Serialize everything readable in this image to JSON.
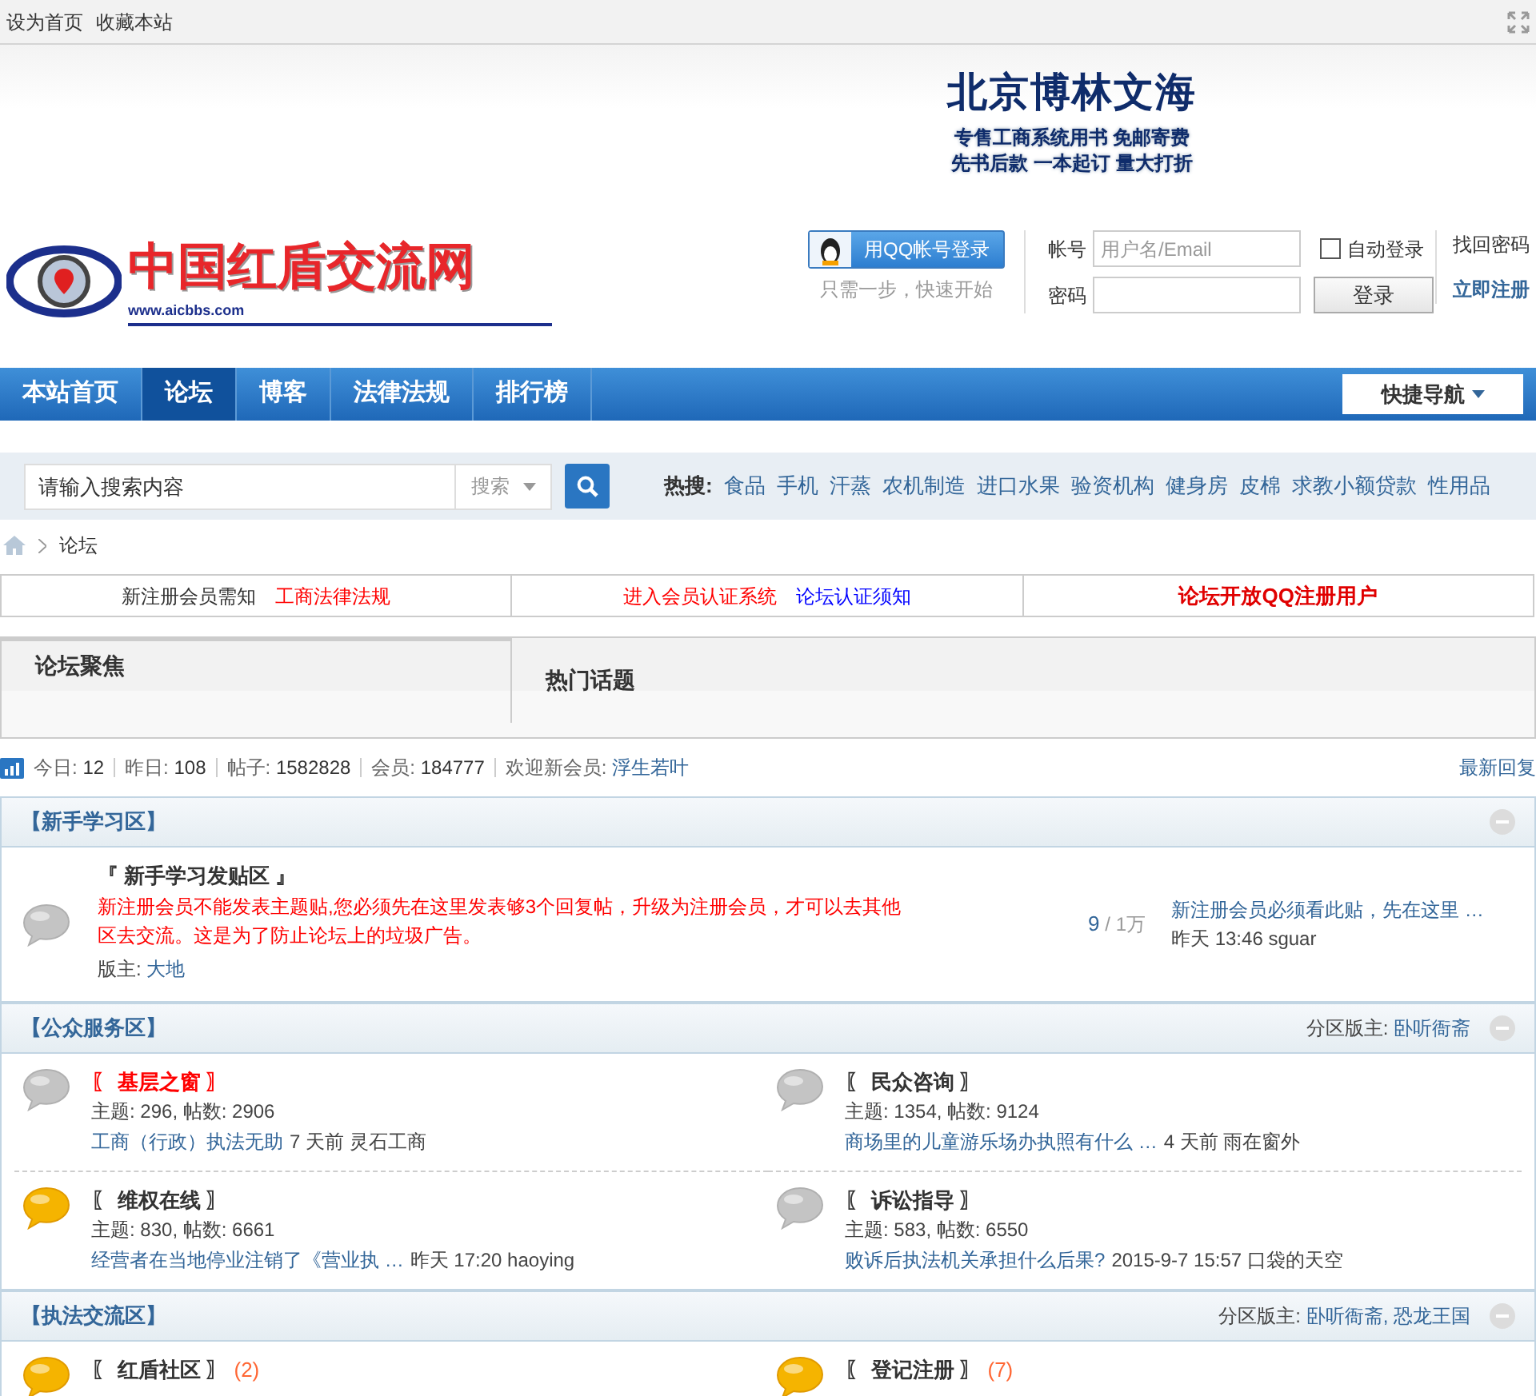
{
  "top_links": [
    "设为首页",
    "收藏本站"
  ],
  "ad": {
    "title": "北京博林文海",
    "lines": [
      "专售工商系统用书  免邮寄费",
      "先书后款  一本起订  量大打折"
    ]
  },
  "logo": {
    "title": "中国红盾交流网",
    "url": "www.aicbbs.com"
  },
  "qq_login": {
    "button": "用QQ帐号登录",
    "hint": "只需一步，快速开始"
  },
  "login": {
    "username_label": "帐号",
    "username_placeholder": "用户名/Email",
    "auto_login": {
      "label": "自动登录",
      "checked": false
    },
    "password_label": "密码",
    "submit": "登录",
    "forgot": "找回密码",
    "register": "立即注册"
  },
  "nav": {
    "items": [
      {
        "label": "本站首页",
        "selected": false
      },
      {
        "label": "论坛",
        "selected": true
      },
      {
        "label": "博客",
        "selected": false
      },
      {
        "label": "法律法规",
        "selected": false
      },
      {
        "label": "排行榜",
        "selected": false
      }
    ],
    "quick_nav": "快捷导航"
  },
  "search": {
    "placeholder": "请输入搜索内容",
    "type": "搜索",
    "hot_label": "热搜:",
    "hot": [
      "食品",
      "手机",
      "汗蒸",
      "农机制造",
      "进口水果",
      "验资机构",
      "健身房",
      "皮棉",
      "求教小额贷款",
      "性用品"
    ]
  },
  "breadcrumb": [
    "论坛"
  ],
  "notices": [
    {
      "links": [
        {
          "text": "新注册会员需知",
          "color": "#333333"
        },
        {
          "text": "工商法律法规",
          "color": "#ff0000"
        }
      ]
    },
    {
      "links": [
        {
          "text": "进入会员认证系统",
          "color": "#ff0000"
        },
        {
          "text": "论坛认证须知",
          "color": "#0000ff"
        }
      ]
    },
    {
      "links": [
        {
          "text": "论坛开放QQ注册用户",
          "color": "#e00000"
        }
      ]
    }
  ],
  "focus_tabs": [
    {
      "label": "论坛聚焦",
      "selected": true
    },
    {
      "label": "热门话题",
      "selected": false
    }
  ],
  "stats": [
    {
      "label": "今日:",
      "value": "12"
    },
    {
      "label": "昨日:",
      "value": "108"
    },
    {
      "label": "帖子:",
      "value": "1582828"
    },
    {
      "label": "会员:",
      "value": "184777"
    }
  ],
  "new_member": {
    "label": "欢迎新会员:",
    "name": "浮生若叶"
  },
  "latest_replies": "最新回复",
  "sections": [
    {
      "title": "【新手学习区】",
      "kind": "wide",
      "forums": [
        {
          "name": "『 新手学习发贴区 』",
          "new": false,
          "description": "新注册会员不能发表主题贴,您必须先在这里发表够3个回复帖，升级为注册会员，才可以去其他区去交流。这是为了防止论坛上的垃圾广告。",
          "moderator_label": "版主:",
          "moderator": "大地",
          "threads": "9",
          "separator": "/",
          "posts": "1万",
          "last_title": "新注册会员必须看此贴，先在这里 …",
          "last_meta": "昨天 13:46 sguar"
        }
      ]
    },
    {
      "title": "【公众服务区】",
      "kind": "grid",
      "moderators_label": "分区版主:",
      "moderators": "卧听衙斋",
      "forums": [
        {
          "name": "〖 基层之窗 〗",
          "color": "#ff0000",
          "new": false,
          "stats": "主题: 296, 帖数: 2906",
          "last_title": "工商（行政）执法无助",
          "last_meta": "7 天前  灵石工商"
        },
        {
          "name": "〖 民众咨询 〗",
          "color": "#333333",
          "new": false,
          "stats": "主题: 1354, 帖数: 9124",
          "last_title": "商场里的儿童游乐场办执照有什么 …",
          "last_meta": "4 天前  雨在窗外"
        },
        {
          "name": "〖 维权在线 〗",
          "color": "#333333",
          "new": true,
          "stats": "主题: 830, 帖数: 6661",
          "last_title": "经营者在当地停业注销了《营业执 …",
          "last_meta": "昨天 17:20 haoying"
        },
        {
          "name": "〖 诉讼指导 〗",
          "color": "#333333",
          "new": false,
          "stats": "主题: 583, 帖数: 6550",
          "last_title": "败诉后执法机关承担什么后果?",
          "last_meta": "2015-9-7 15:57 口袋的天空"
        }
      ]
    },
    {
      "title": "【执法交流区】",
      "kind": "grid",
      "moderators_label": "分区版主:",
      "moderators": "卧听衙斋, 恐龙王国",
      "forums": [
        {
          "name": "〖 红盾社区 〗",
          "color": "#333333",
          "new": true,
          "today": "(2)"
        },
        {
          "name": "〖 登记注册 〗",
          "color": "#333333",
          "new": true,
          "today": "(7)"
        }
      ]
    }
  ]
}
